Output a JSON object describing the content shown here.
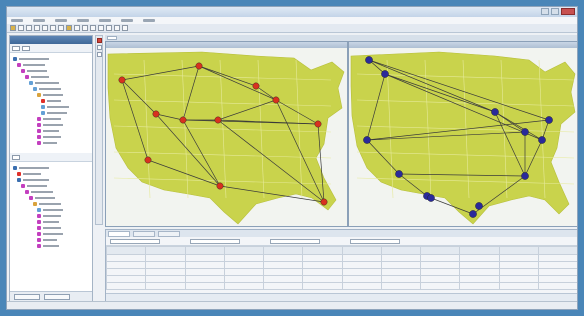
{
  "window": {
    "title": "",
    "menu_items": [
      "",
      "",
      "",
      "",
      "",
      "",
      ""
    ]
  },
  "toolbar": {
    "icons": [
      "open-icon",
      "save-icon",
      "cut-icon",
      "copy-icon",
      "paste-icon",
      "undo-icon",
      "redo-icon",
      "zoom-in-icon",
      "zoom-out-icon",
      "pan-icon",
      "select-icon",
      "route-icon",
      "refresh-icon",
      "settings-icon",
      "help-icon"
    ]
  },
  "navigator": {
    "title": "",
    "buttons": [
      "",
      ""
    ]
  },
  "maps": {
    "land_color": "#c9d34c",
    "edge_color": "#3a3a3a",
    "left": {
      "node_color": "#d8321f",
      "node_count": 11,
      "edge_count": 20,
      "node_labels": [
        "",
        "",
        "",
        "",
        "",
        "",
        "",
        "",
        "",
        "",
        ""
      ]
    },
    "right": {
      "node_color": "#2a2a9a",
      "node_count": 13,
      "edge_count": 20,
      "node_labels": [
        "",
        "",
        "",
        "",
        "",
        "",
        "",
        "",
        "",
        "",
        "",
        "",
        ""
      ]
    }
  },
  "grid": {
    "tabs": [
      "",
      "",
      ""
    ],
    "columns": [
      "",
      "",
      "",
      "",
      "",
      "",
      "",
      "",
      "",
      "",
      "",
      ""
    ],
    "rows": [
      [
        "",
        "",
        "",
        "",
        "",
        "",
        "",
        "",
        "",
        "",
        "",
        ""
      ],
      [
        "",
        "",
        "",
        "",
        "",
        "",
        "",
        "",
        "",
        "",
        "",
        ""
      ],
      [
        "",
        "",
        "",
        "",
        "",
        "",
        "",
        "",
        "",
        "",
        "",
        ""
      ],
      [
        "",
        "",
        "",
        "",
        "",
        "",
        "",
        "",
        "",
        "",
        "",
        ""
      ],
      [
        "",
        "",
        "",
        "",
        "",
        "",
        "",
        "",
        "",
        "",
        "",
        ""
      ]
    ]
  },
  "colors": {
    "selection": "#e0302a",
    "accent": "#3f6898"
  }
}
